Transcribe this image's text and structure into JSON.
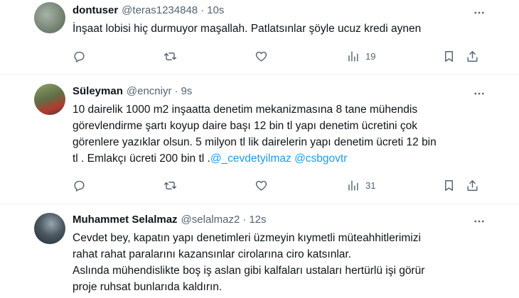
{
  "tweets": [
    {
      "name": "dontuser",
      "handle": "@teras1234848",
      "separator": "·",
      "time": "10s",
      "text": "İnşaat lobisi hiç durmuyor maşallah. Patlatsınlar şöyle ucuz kredi aynen",
      "mentions": "",
      "views": "19",
      "avatar_colors": [
        "#6b7b6a",
        "#a9b3a8"
      ]
    },
    {
      "name": "Süleyman",
      "handle": "@encniyr",
      "separator": "·",
      "time": "9s",
      "text": "10 dairelik 1000 m2 inşaatta denetim mekanizmasına 8 tane mühendis\ngörevlendirme şartı koyup daire başı 12 bin tl yapı denetim ücretini çok\ngörenlere yazıklar olsun. 5 milyon tl lik dairelerin yapı denetim ücreti 12 bin\ntl . Emlakçı ücreti 200 bin tl .",
      "mentions": "@_cevdetyilmaz @csbgovtr",
      "views": "31",
      "avatar_colors": [
        "#7a8c5e",
        "#c0392b"
      ]
    },
    {
      "name": "Muhammet Selalmaz",
      "handle": "@selalmaz2",
      "separator": "·",
      "time": "12s",
      "text": "Cevdet bey,  kapatın yapı denetimleri üzmeyin kıymetli müteahhitlerimizi\nrahat rahat paralarını kazansınlar cirolarına ciro katsınlar.\nAslında mühendislikte boş iş aslan gibi kalfaları ustaları hertürlü işi görür\nproje ruhsat bunlarıda kaldırın.",
      "mentions": "",
      "views": "",
      "avatar_colors": [
        "#2f3b44",
        "#9aa5ad"
      ]
    }
  ],
  "colors": {
    "text": "#0f1419",
    "secondary": "#536471",
    "link": "#1d9bf0",
    "divider": "#eff3f4"
  }
}
